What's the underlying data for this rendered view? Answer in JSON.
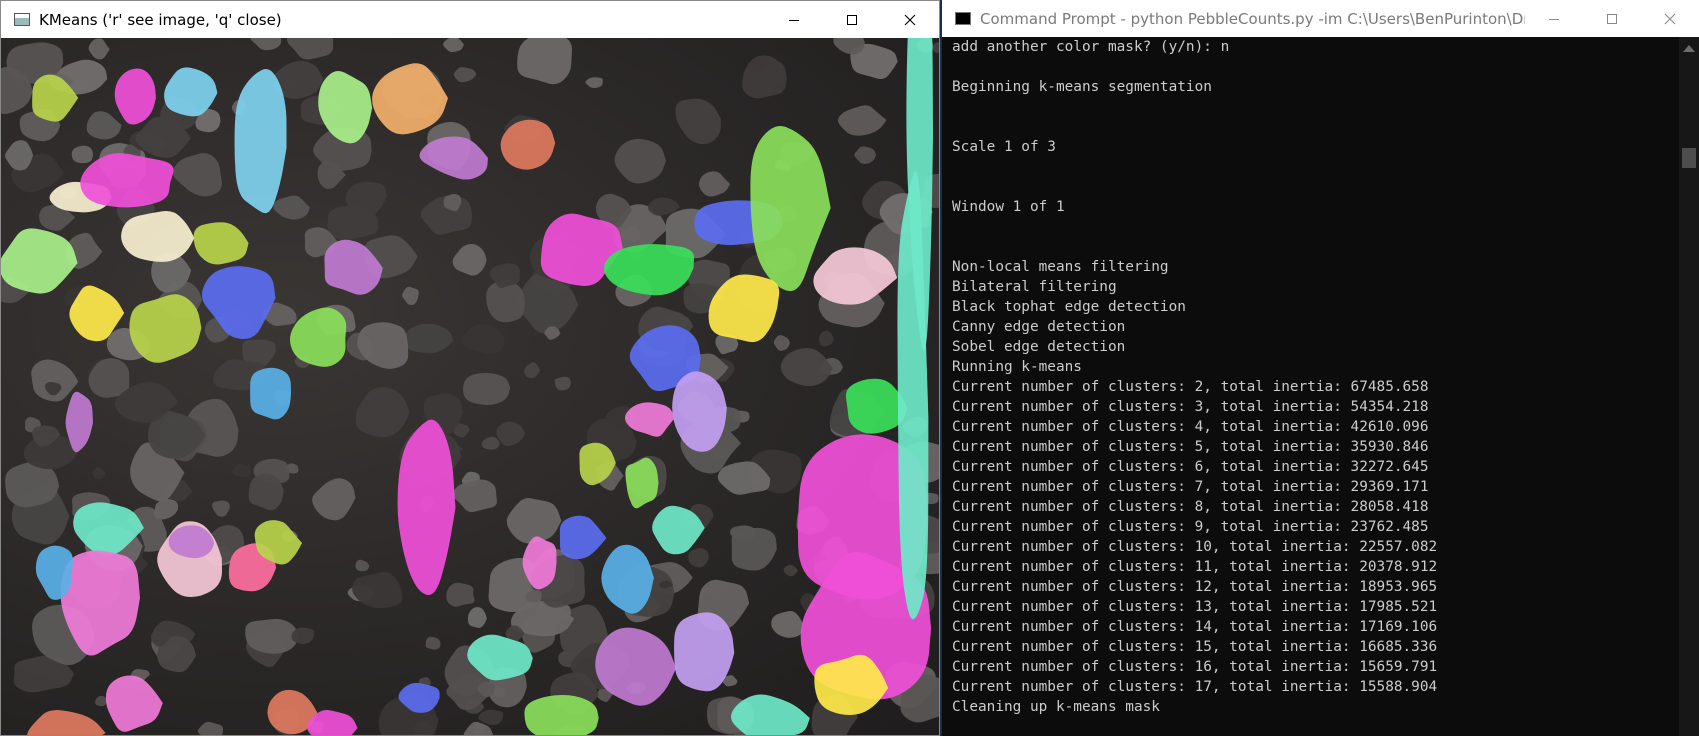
{
  "kmeans_window": {
    "title": "KMeans ('r' see image, 'q' close)",
    "icon": "opencv-window-icon",
    "controls": [
      "minimize",
      "maximize",
      "close"
    ]
  },
  "cmd_window": {
    "title": "Command Prompt - python  PebbleCounts.py -im C:\\Users\\BenPurinton\\Dropb...",
    "icon": "cmd-icon",
    "controls": [
      "minimize",
      "maximize",
      "close"
    ],
    "lines": [
      "add another color mask? (y/n): n",
      "",
      "Beginning k-means segmentation",
      "",
      "",
      "Scale 1 of 3",
      "",
      "",
      "Window 1 of 1",
      "",
      "",
      "Non-local means filtering",
      "Bilateral filtering",
      "Black tophat edge detection",
      "Canny edge detection",
      "Sobel edge detection",
      "Running k-means",
      "Current number of clusters: 2, total inertia: 67485.658",
      "Current number of clusters: 3, total inertia: 54354.218",
      "Current number of clusters: 4, total inertia: 42610.096",
      "Current number of clusters: 5, total inertia: 35930.846",
      "Current number of clusters: 6, total inertia: 32272.645",
      "Current number of clusters: 7, total inertia: 29369.171",
      "Current number of clusters: 8, total inertia: 28058.418",
      "Current number of clusters: 9, total inertia: 23762.485",
      "Current number of clusters: 10, total inertia: 22557.082",
      "Current number of clusters: 11, total inertia: 20378.912",
      "Current number of clusters: 12, total inertia: 18953.965",
      "Current number of clusters: 13, total inertia: 17985.521",
      "Current number of clusters: 14, total inertia: 17169.106",
      "Current number of clusters: 15, total inertia: 16685.336",
      "Current number of clusters: 16, total inertia: 15659.791",
      "Current number of clusters: 17, total inertia: 15588.904",
      "Cleaning up k-means mask"
    ]
  },
  "colors": {
    "desktop": "#1a2f4a",
    "console_bg": "#0c0c0c",
    "console_text": "#cccccc",
    "pebble_gray": "#4a4747",
    "segment_palette": [
      "#b8d44a",
      "#f04fd8",
      "#7fd3f0",
      "#9b6cf0",
      "#a8f08a",
      "#f2b06a",
      "#c07ad0",
      "#ffe94a",
      "#39e05a",
      "#5a6df0",
      "#f07ad8",
      "#f6c9d8",
      "#6ee8c8",
      "#ff6fa0",
      "#c2a0f2",
      "#8ae05a",
      "#f8f0d0",
      "#5ab0e8",
      "#e07a60",
      "#a0e0a0"
    ]
  }
}
